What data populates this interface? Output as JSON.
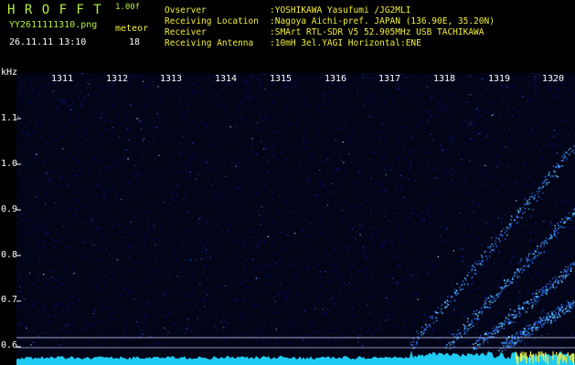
{
  "header": {
    "logo": "H R O F F T",
    "version": "1.00f",
    "filename": "YY2611111310.png",
    "mode_label": "meteor",
    "datetime": "26.11.11 13:10",
    "count": "18"
  },
  "info": [
    {
      "label": "Ovserver",
      "value": ":YOSHIKAWA Yasufumi /JG2MLI"
    },
    {
      "label": "Receiving Location",
      "value": ":Nagoya Aichi-pref. JAPAN (136.90E, 35.20N)"
    },
    {
      "label": "Receiver",
      "value": ":SMArt RTL-SDR V5 52.905MHz USB TACHIKAWA"
    },
    {
      "label": "Receiving Antenna",
      "value": ":10mH 3el.YAGI Horizontal:ENE"
    }
  ],
  "axes": {
    "y_unit": "kHz",
    "x_ticks": [
      "1311",
      "1312",
      "1313",
      "1314",
      "1315",
      "1316",
      "1317",
      "1318",
      "1319",
      "1320"
    ],
    "y_ticks": [
      "1.1",
      "1.0",
      "0.9",
      "0.8",
      "0.7",
      "0.6"
    ]
  },
  "colors": {
    "background": "#000000",
    "noise_floor": "#0b1a8a",
    "signal": "#5fd0ff",
    "baseline": "#22d6ff",
    "label_green": "#b6f23c",
    "label_yellow": "#f2ef3a"
  }
}
